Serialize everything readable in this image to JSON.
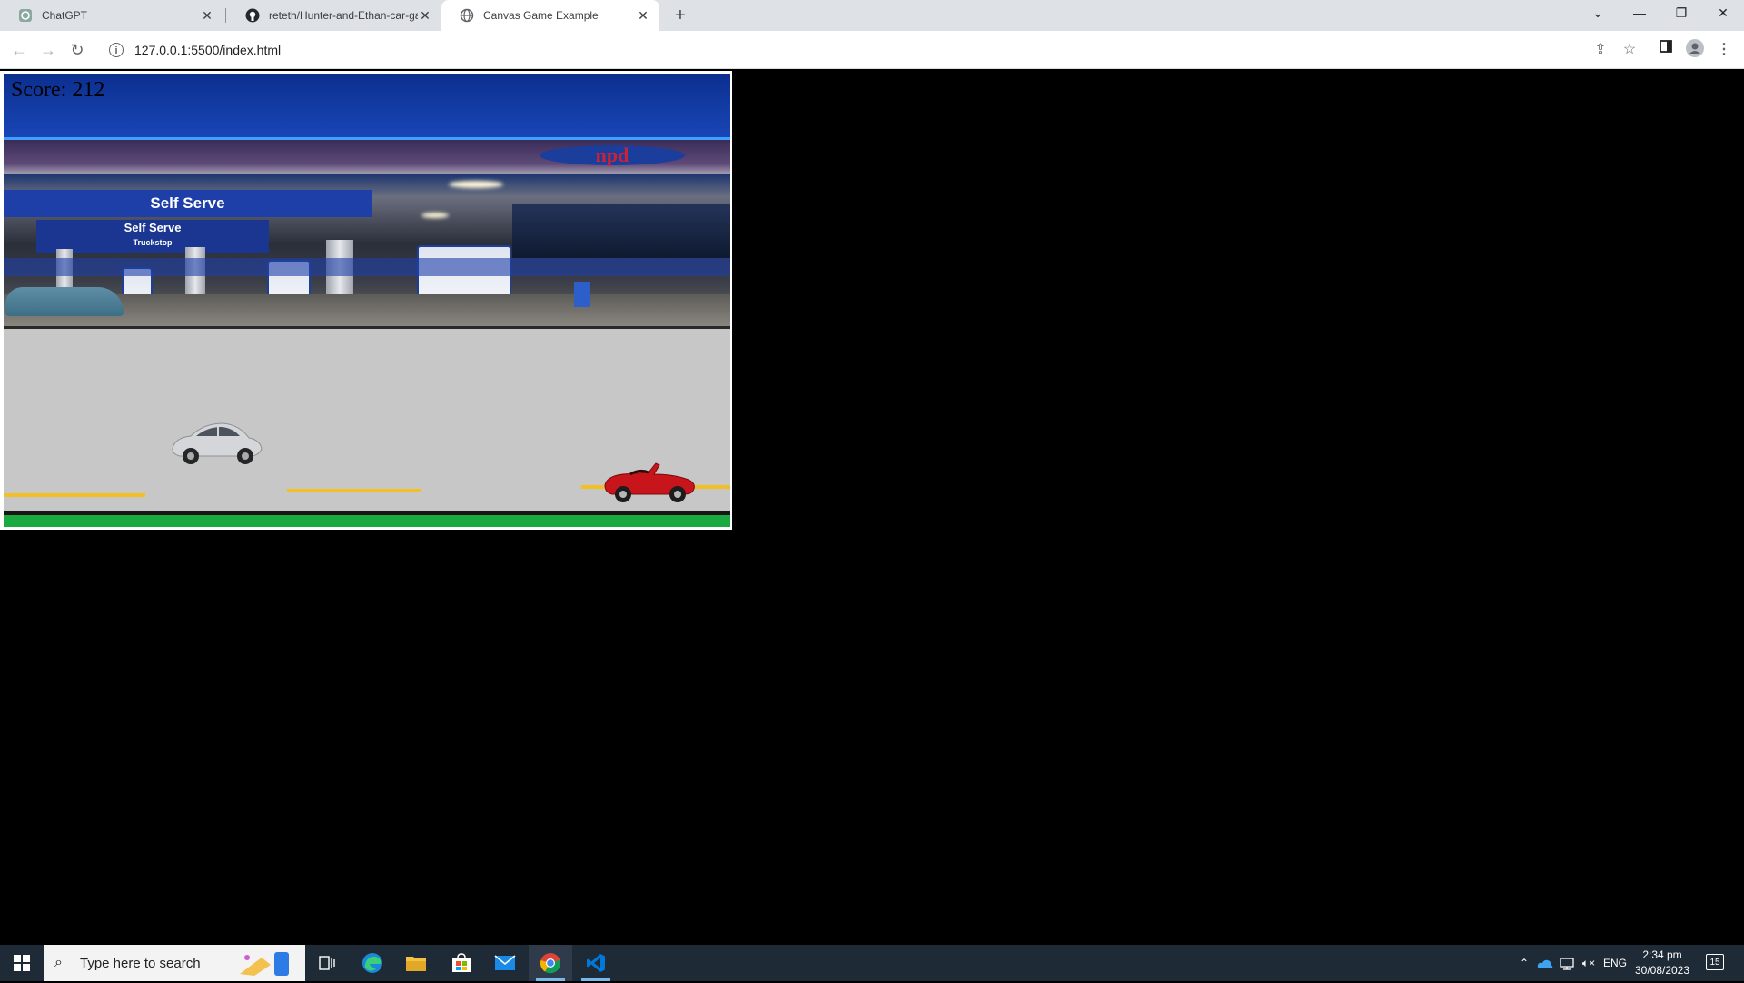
{
  "browser": {
    "tabs": [
      {
        "title": "ChatGPT",
        "icon": "chatgpt-icon",
        "active": false
      },
      {
        "title": "reteth/Hunter-and-Ethan-car-gar",
        "icon": "github-icon",
        "active": false
      },
      {
        "title": "Canvas Game Example",
        "icon": "globe-icon",
        "active": true
      }
    ],
    "new_tab": "+",
    "url": "127.0.0.1:5500/index.html"
  },
  "game": {
    "score_text": "Score: 212",
    "brand_sign": "npd",
    "sign_main": "Self Serve",
    "sign_secondary": "Self Serve",
    "sign_sub": "Truckstop",
    "colors": {
      "sky": "#1947b8",
      "road": "#c7c7c7",
      "lane": "#f3c024",
      "grass": "#1aaa40",
      "player_car": "#c8151b",
      "obstacle_car": "#d4d6da"
    }
  },
  "taskbar": {
    "search_placeholder": "Type here to search",
    "tray": {
      "language": "ENG"
    },
    "clock": {
      "time": "2:34 pm",
      "date": "30/08/2023"
    },
    "notifications": "15"
  }
}
